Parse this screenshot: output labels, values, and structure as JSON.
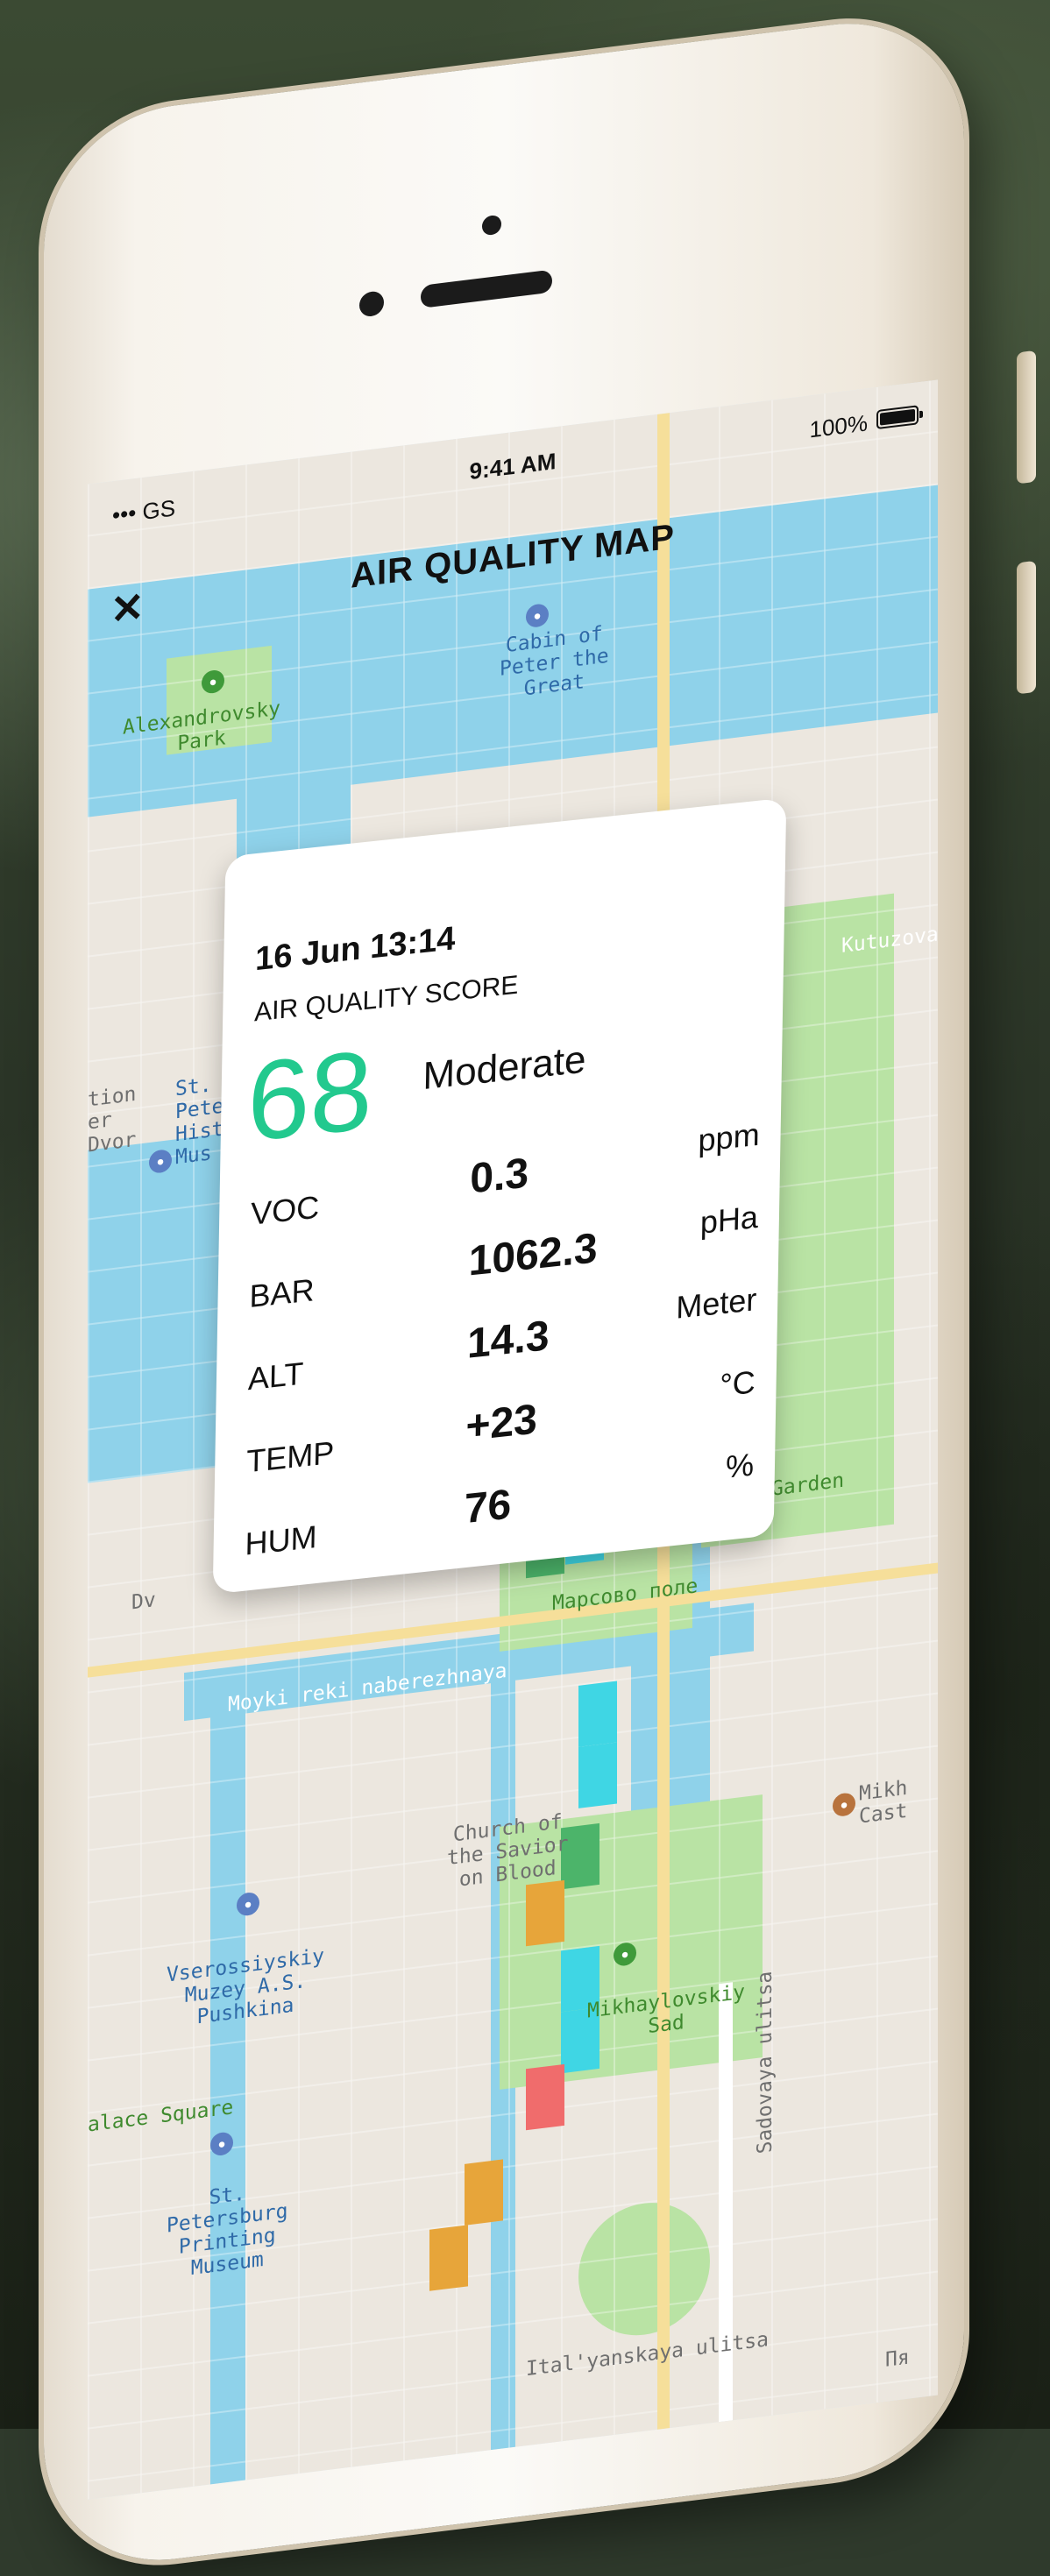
{
  "status_bar": {
    "signal": "••• GS",
    "time": "9:41 AM",
    "battery": "100%"
  },
  "header": {
    "title": "AIR QUALITY MAP",
    "close_label": "✕"
  },
  "card": {
    "date": "16 Jun 13:14",
    "score_label": "AIR QUALITY SCORE",
    "score": "68",
    "level": "Moderate",
    "metrics": [
      {
        "label": "VOC",
        "value": "0.3",
        "unit": "ppm"
      },
      {
        "label": "BAR",
        "value": "1062.3",
        "unit": "pHa"
      },
      {
        "label": "ALT",
        "value": "14.3",
        "unit": "Meter"
      },
      {
        "label": "TEMP",
        "value": "+23",
        "unit": "°C"
      },
      {
        "label": "HUM",
        "value": "76",
        "unit": "%"
      }
    ]
  },
  "map": {
    "labels": {
      "alexandrovsky_park": "Alexandrovsky\nPark",
      "cabin": "Cabin of\nPeter the\nGreat",
      "station": "tion\ner\nDvor",
      "st_peter_museum": "St.\nPete\nHist\nMus",
      "kutuzova": "Kutuzova",
      "summer_garden": "Garden",
      "marsovo": "Марсово поле",
      "moyki": "Moyki reki naberezhnaya",
      "church": "Church of\nthe Savior\non Blood",
      "vserossiyskiy": "Vserossiyskiy\nMuzey A.S.\nPushkina",
      "mikhaylovskiy_sad": "Mikhaylovskiy\nSad",
      "mikh_castle": "Mikh\nCast",
      "palace_square": "alace Square",
      "printing_museum": "St.\nPetersburg\nPrinting\nMuseum",
      "sadovaya": "Sadovaya ulitsa",
      "italyanskaya": "Ital'yanskaya ulitsa",
      "dv": "Dv",
      "pya": "Пя"
    },
    "colors": {
      "teal": "#3fd6e4",
      "green": "#4cb46a",
      "orange": "#e7a53a",
      "red": "#f06c6c"
    }
  }
}
